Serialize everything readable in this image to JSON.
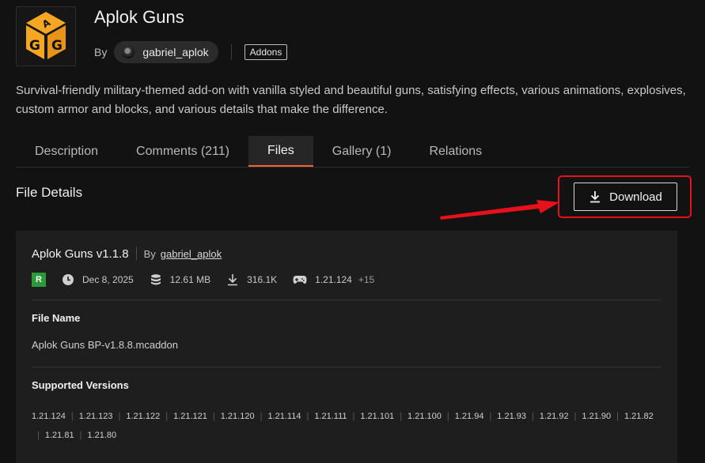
{
  "project": {
    "title": "Aplok Guns",
    "by_label": "By",
    "author": "gabriel_aplok",
    "tag": "Addons",
    "summary": "Survival-friendly military-themed add-on with vanilla styled and beautiful guns, satisfying effects, various animations, explosives, custom armor and blocks, and various details that make the difference."
  },
  "tabs": [
    {
      "label": "Description",
      "active": false
    },
    {
      "label": "Comments (211)",
      "active": false
    },
    {
      "label": "Files",
      "active": true
    },
    {
      "label": "Gallery (1)",
      "active": false
    },
    {
      "label": "Relations",
      "active": false
    }
  ],
  "file_details": {
    "heading": "File Details",
    "download_label": "Download",
    "file_title": "Aplok Guns v1.1.8",
    "by_label": "By",
    "author": "gabriel_aplok",
    "release_badge": "R",
    "date": "Dec 8, 2025",
    "size": "12.61 MB",
    "downloads": "316.1K",
    "game_version": "1.21.124",
    "more_versions": "+15",
    "file_name_label": "File Name",
    "file_name": "Aplok Guns BP-v1.8.8.mcaddon",
    "supported_versions_label": "Supported Versions",
    "supported_versions": [
      "1.21.124",
      "1.21.123",
      "1.21.122",
      "1.21.121",
      "1.21.120",
      "1.21.114",
      "1.21.111",
      "1.21.101",
      "1.21.100",
      "1.21.94",
      "1.21.93",
      "1.21.92",
      "1.21.90",
      "1.21.82",
      "1.21.81",
      "1.21.80"
    ]
  },
  "icons": {
    "logo": "aplok-cube-logo-icon",
    "date": "clock-icon",
    "size": "database-icon",
    "downloads": "download-icon",
    "game": "gamepad-icon",
    "download_button": "download-icon"
  },
  "colors": {
    "accent_tab": "#f16436",
    "release_badge": "#2a9a3a",
    "annotation_red": "#e8101a",
    "logo_orange": "#f5a623"
  }
}
